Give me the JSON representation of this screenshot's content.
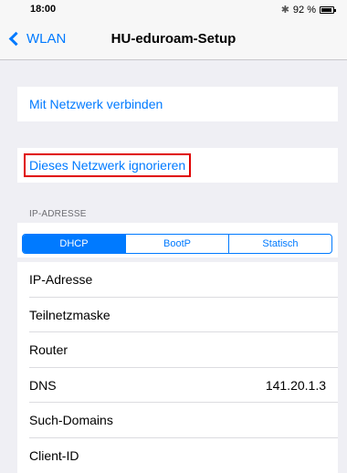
{
  "status": {
    "time": "18:00",
    "bluetooth_icon": "bluetooth-icon",
    "battery_percent": "92 %"
  },
  "nav": {
    "back_label": "WLAN",
    "title": "HU-eduroam-Setup"
  },
  "actions": {
    "connect": "Mit Netzwerk verbinden",
    "forget": "Dieses Netzwerk ignorieren"
  },
  "ip_section": {
    "header": "IP-ADRESSE",
    "segments": [
      "DHCP",
      "BootP",
      "Statisch"
    ],
    "selected_segment": "DHCP",
    "rows": [
      {
        "label": "IP-Adresse",
        "value": ""
      },
      {
        "label": "Teilnetzmaske",
        "value": ""
      },
      {
        "label": "Router",
        "value": ""
      },
      {
        "label": "DNS",
        "value": "141.20.1.3"
      },
      {
        "label": "Such-Domains",
        "value": ""
      },
      {
        "label": "Client-ID",
        "value": ""
      }
    ]
  },
  "colors": {
    "accent": "#007aff",
    "highlight_border": "#e00000",
    "background": "#efeff4"
  }
}
